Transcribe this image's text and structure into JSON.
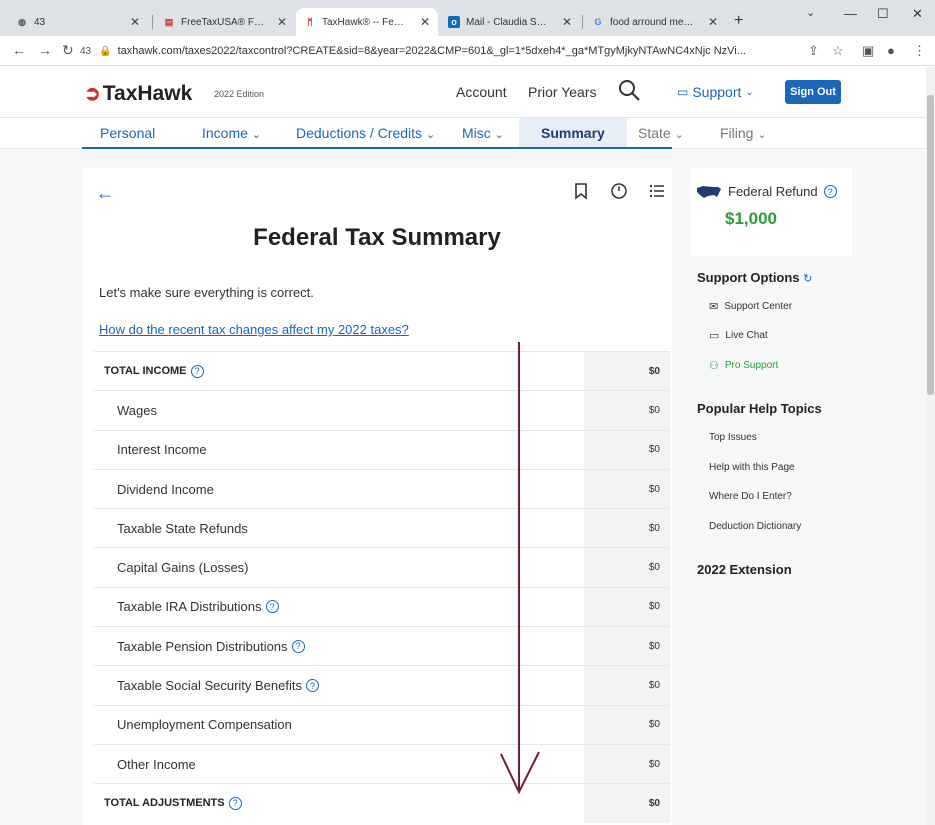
{
  "browser": {
    "tabs": [
      {
        "label": "43",
        "icon": "globe-icon"
      },
      {
        "label": "FreeTaxUSA® FREE Ta",
        "icon": "flag-icon"
      },
      {
        "label": "TaxHawk® -- Federal",
        "icon": "taxhawk-icon"
      },
      {
        "label": "Mail - Claudia Sane -",
        "icon": "outlook-icon"
      },
      {
        "label": "food arround me - G",
        "icon": "google-icon"
      }
    ],
    "tab_count": "43",
    "url": "taxhawk.com/taxes2022/taxcontrol?CREATE&sid=8&year=2022&CMP=601&_gl=1*5dxeh4*_ga*MTgyMjkyNTAwNC4xNjc NzVi..."
  },
  "header": {
    "logo": "TaxHawk",
    "edition": "2022 Edition",
    "account": "Account",
    "prior_years": "Prior Years",
    "support": "Support",
    "sign_out": "Sign Out"
  },
  "nav": {
    "personal": "Personal",
    "income": "Income",
    "deductions": "Deductions / Credits",
    "misc": "Misc",
    "summary": "Summary",
    "state": "State",
    "filing": "Filing"
  },
  "main": {
    "title": "Federal Tax Summary",
    "intro": "Let's make sure everything is correct.",
    "link": "How do the recent tax changes affect my 2022 taxes?",
    "rows": [
      {
        "label": "TOTAL INCOME",
        "amount": "$0",
        "total": true,
        "help": true
      },
      {
        "label": "Wages",
        "amount": "$0"
      },
      {
        "label": "Interest Income",
        "amount": "$0"
      },
      {
        "label": "Dividend Income",
        "amount": "$0"
      },
      {
        "label": "Taxable State Refunds",
        "amount": "$0"
      },
      {
        "label": "Capital Gains (Losses)",
        "amount": "$0"
      },
      {
        "label": "Taxable IRA Distributions",
        "amount": "$0",
        "help": true
      },
      {
        "label": "Taxable Pension Distributions",
        "amount": "$0",
        "help": true
      },
      {
        "label": "Taxable Social Security Benefits",
        "amount": "$0",
        "help": true
      },
      {
        "label": "Unemployment Compensation",
        "amount": "$0"
      },
      {
        "label": "Other Income",
        "amount": "$0"
      },
      {
        "label": "TOTAL ADJUSTMENTS",
        "amount": "$0",
        "total": true,
        "help": true
      }
    ]
  },
  "sidebar": {
    "refund_label": "Federal Refund",
    "refund_amount": "$1,000",
    "support_heading": "Support Options",
    "support_center": "Support Center",
    "live_chat": "Live Chat",
    "pro_support": "Pro Support",
    "help_heading": "Popular Help Topics",
    "top_issues": "Top Issues",
    "help_page": "Help with this Page",
    "where_enter": "Where Do I Enter?",
    "deduction_dictionary": "Deduction Dictionary",
    "extension": "2022 Extension"
  },
  "colors": {
    "accent": "#1a66b8",
    "refund": "#2a9d3a",
    "brand_red": "#d42c2c"
  }
}
